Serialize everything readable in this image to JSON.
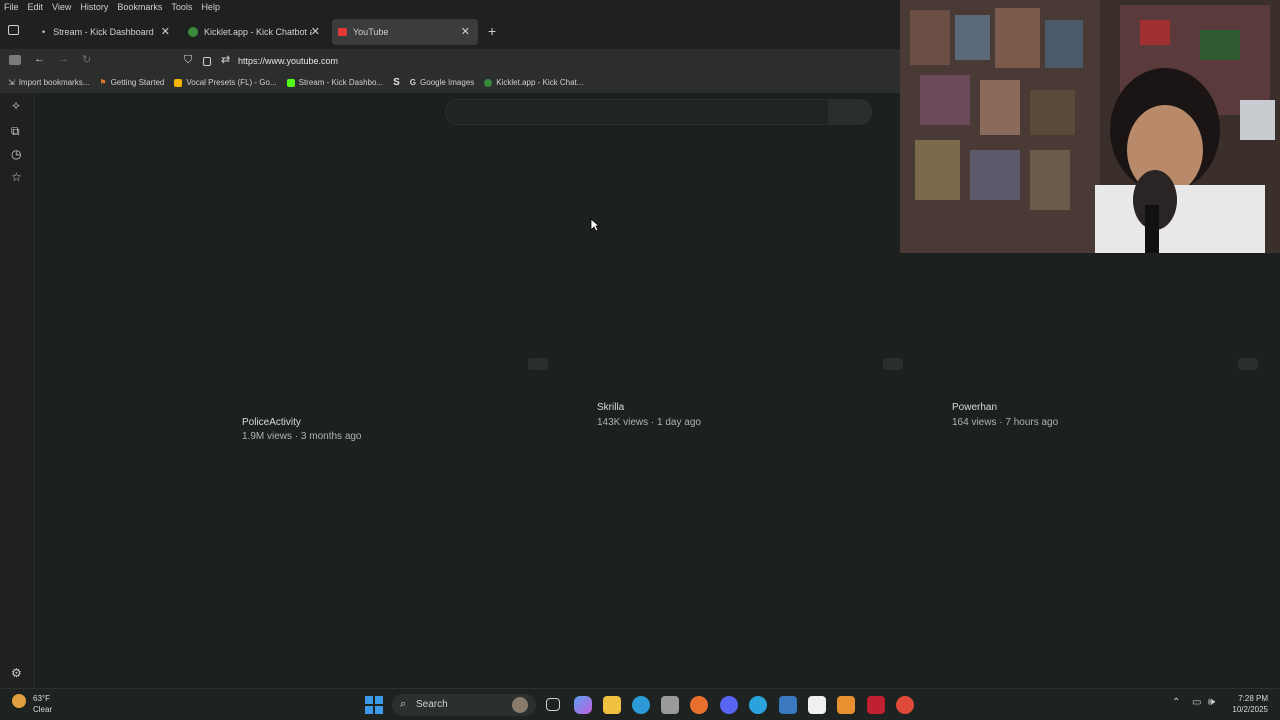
{
  "menu": [
    "File",
    "Edit",
    "View",
    "History",
    "Bookmarks",
    "Tools",
    "Help"
  ],
  "tabs": [
    {
      "label": "Stream - Kick Dashboard",
      "active": false
    },
    {
      "label": "Kicklet.app - Kick Chatbot and C",
      "active": false
    },
    {
      "label": "YouTube",
      "active": true
    }
  ],
  "url": "https://www.youtube.com",
  "bookmarks": [
    "Import bookmarks...",
    "Getting Started",
    "Vocal Presets (FL) - Go...",
    "Stream - Kick Dashbo...",
    "Google Images",
    "Kicklet.app - Kick Chat..."
  ],
  "videos": [
    {
      "channel": "PoliceActivity",
      "meta": "1.9M views · 3 months ago"
    },
    {
      "channel": "Skrilla",
      "meta": "143K views · 1 day ago"
    },
    {
      "channel": "Powerhan",
      "meta": "164 views · 7 hours ago"
    }
  ],
  "taskbar": {
    "search_label": "Search",
    "weather_temp": "63°F",
    "weather_desc": "Clear",
    "time": "7:28 PM",
    "date": "10/2/2025"
  },
  "colors": {
    "background": "#1c201f",
    "tab_active": "#3a3d3c",
    "youtube_red": "#e53935"
  }
}
